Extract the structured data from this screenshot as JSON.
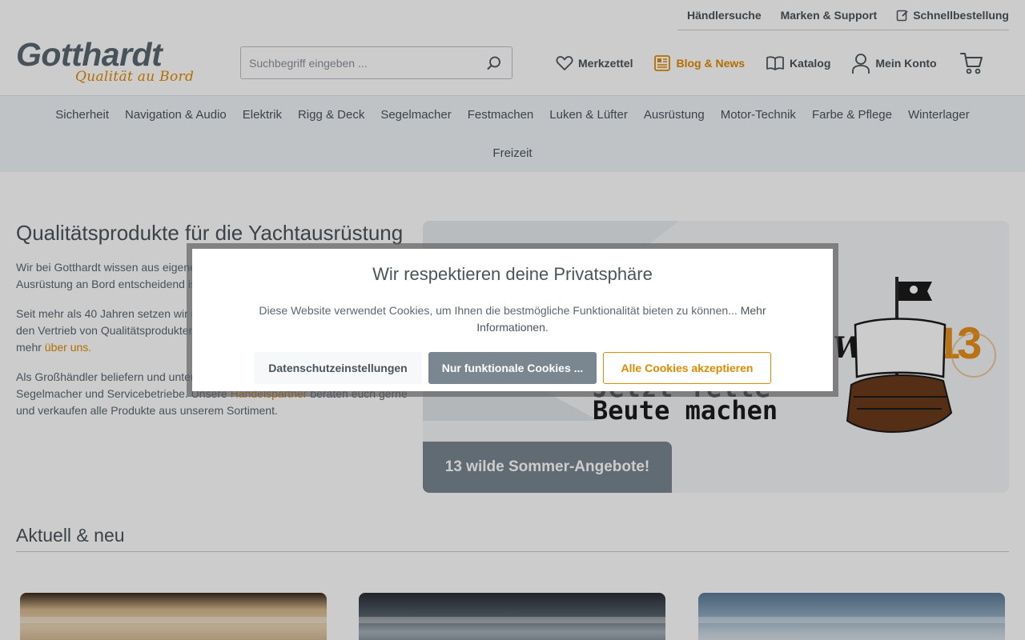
{
  "topbar": {
    "links": [
      "Händlersuche",
      "Marken & Support",
      "Schnellbestellung"
    ]
  },
  "logo": {
    "brand": "Gotthardt",
    "tagline": "Qualität au Bord"
  },
  "search": {
    "placeholder": "Suchbegriff eingeben ..."
  },
  "header_actions": {
    "wishlist": "Merkzettel",
    "blog": "Blog & News",
    "catalog": "Katalog",
    "account": "Mein Konto"
  },
  "nav": {
    "items": [
      "Sicherheit",
      "Navigation & Audio",
      "Elektrik",
      "Rigg & Deck",
      "Segelmacher",
      "Festmachen",
      "Luken & Lüfter",
      "Ausrüstung",
      "Motor-Technik",
      "Farbe & Pflege",
      "Winterlager"
    ],
    "second_row": "Freizeit"
  },
  "intro": {
    "heading": "Qualitätsprodukte für die Yachtausrüstung",
    "p1": "Wir bei Gotthardt wissen aus eigener Erfahrung, wie wichtig die richtige Ausrüstung an Bord entscheidend ist.",
    "p2_pre": "Seit mehr als 40 Jahren setzen wir uns für die Entwicklung, Produktion und den Vertrieb von Qualitätsprodukten für den Wassersport ein. Hier erfahrt ihr mehr ",
    "p2_link": "über uns.",
    "p3_pre": "Als Großhändler beliefern und unterstützen wir Fachhändler, Werften, Segelmacher und Servicebetriebe. Unsere ",
    "p3_link": "Handelspartner",
    "p3_post": " beraten euch gerne und verkaufen alle Produkte aus unserem Sortiment."
  },
  "teaser": {
    "title_word": "Wilden",
    "number": "13",
    "slogan_line1": "Jetzt fette",
    "slogan_line2": "Beute machen",
    "label": "13 wilde Sommer-Angebote!"
  },
  "section": {
    "title": "Aktuell & neu"
  },
  "cookie": {
    "title": "Wir respektieren deine Privatsphäre",
    "message": "Diese Website verwendet Cookies, um Ihnen die bestmögliche Funktionalität bieten zu können...",
    "more_link": "Mehr Informationen",
    "btn_settings": "Datenschutzeinstellungen",
    "btn_functional": "Nur funktionale Cookies ...",
    "btn_accept": "Alle Cookies akzeptieren"
  },
  "colors": {
    "accent": "#e08a00",
    "text": "#4a545b",
    "nav_bg": "#f1f4f7",
    "button_gray": "#7a8690"
  }
}
